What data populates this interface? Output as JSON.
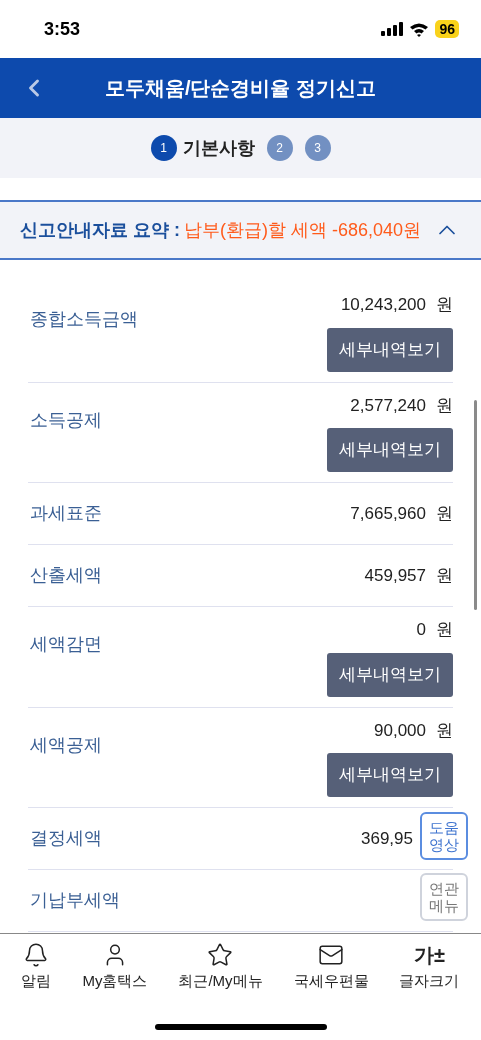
{
  "status_bar": {
    "time": "3:53",
    "battery": "96"
  },
  "header": {
    "title": "모두채움/단순경비율 정기신고"
  },
  "steps": [
    {
      "number": "1",
      "label": "기본사항",
      "selected": true
    },
    {
      "number": "2",
      "selected": false
    },
    {
      "number": "3",
      "selected": false
    }
  ],
  "summary": {
    "label": "신고안내자료 요약 :",
    "amount": "납부(환급)할 세액 -686,040원",
    "expanded": true
  },
  "rows": [
    {
      "kind": "detail",
      "label": "종합소득금액",
      "amount": "10,243,200",
      "unit": "원",
      "button": "세부내역보기"
    },
    {
      "kind": "detail",
      "label": "소득공제",
      "amount": "2,577,240",
      "unit": "원",
      "button": "세부내역보기"
    },
    {
      "kind": "plain",
      "label": "과세표준",
      "amount": "7,665,960",
      "unit": "원"
    },
    {
      "kind": "plain",
      "label": "산출세액",
      "amount": "459,957",
      "unit": "원"
    },
    {
      "kind": "detail",
      "label": "세액감면",
      "amount": "0",
      "unit": "원",
      "button": "세부내역보기"
    },
    {
      "kind": "detail",
      "label": "세액공제",
      "amount": "90,000",
      "unit": "원",
      "button": "세부내역보기"
    },
    {
      "kind": "plain",
      "label": "결정세액",
      "amount": "369,95"
    },
    {
      "kind": "plain",
      "label": "기납부세액"
    }
  ],
  "floating_buttons": [
    {
      "kind": "help",
      "label": "도움영상"
    },
    {
      "kind": "menu",
      "label": "연관메뉴"
    }
  ],
  "bottom_nav": [
    {
      "kind": "bell",
      "label": "알림"
    },
    {
      "kind": "person",
      "label": "My홈택스"
    },
    {
      "kind": "star",
      "label": "최근/My메뉴"
    },
    {
      "kind": "mail",
      "label": "국세우편물"
    },
    {
      "kind": "fontsize",
      "label": "글자크기",
      "glyph": "가±"
    }
  ]
}
